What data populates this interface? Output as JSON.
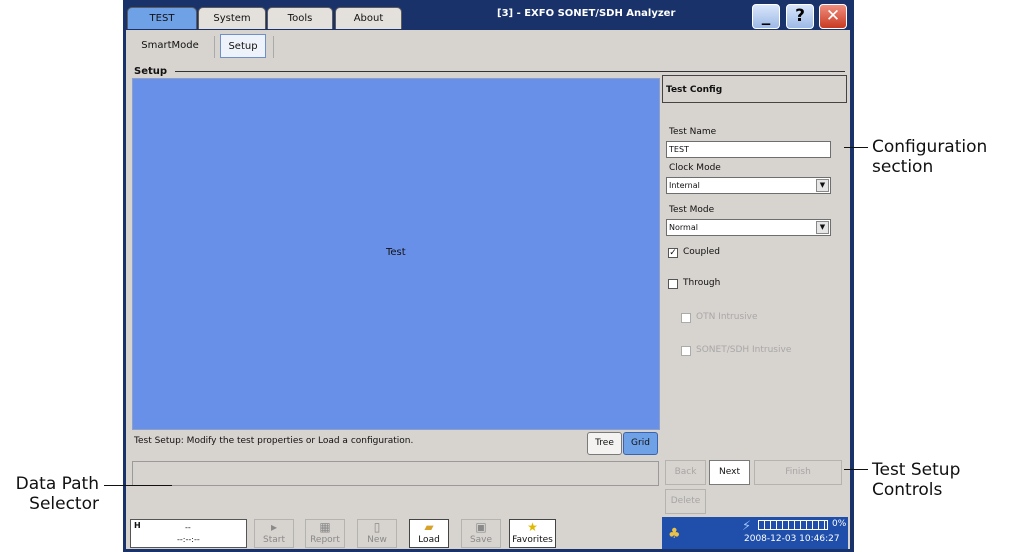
{
  "window": {
    "title": "[3] - EXFO  SONET/SDH Analyzer",
    "min_label": "_",
    "help_label": "?",
    "close_label": "✕"
  },
  "tabs": [
    {
      "label": "TEST",
      "active": true
    },
    {
      "label": "System"
    },
    {
      "label": "Tools"
    },
    {
      "label": "About"
    }
  ],
  "subtabs": [
    {
      "label": "SmartMode"
    },
    {
      "label": "Setup",
      "active": true
    }
  ],
  "setup": {
    "section_label": "Setup",
    "grid_label": "Test",
    "status_text": "Test Setup: Modify the test properties or Load a configuration.",
    "view_tree": "Tree",
    "view_grid": "Grid"
  },
  "config": {
    "header": "Test Config",
    "test_name_label": "Test Name",
    "test_name_value": "TEST",
    "clock_mode_label": "Clock Mode",
    "clock_mode_value": "Internal",
    "test_mode_label": "Test Mode",
    "test_mode_value": "Normal",
    "coupled_label": "Coupled",
    "coupled_checked": true,
    "through_label": "Through",
    "otn_label": "OTN Intrusive",
    "sonet_label": "SONET/SDH Intrusive"
  },
  "nav": {
    "back": "Back",
    "next": "Next",
    "finish": "Finish",
    "delete": "Delete"
  },
  "bottom": {
    "h_label": "H",
    "h_value": "--",
    "h_time": "--:--:--",
    "start": "Start",
    "report": "Report",
    "new": "New",
    "load": "Load",
    "save": "Save",
    "favorites": "Favorites"
  },
  "system": {
    "battery_percent": "0%",
    "timestamp": "2008-12-03 10:46:27"
  },
  "callouts": {
    "config_section": [
      "Configuration",
      "section"
    ],
    "data_path": [
      "Data Path",
      "Selector"
    ],
    "test_setup": [
      "Test Setup",
      "Controls"
    ]
  },
  "colors": {
    "accent": "#6fa1e6",
    "grid_bg": "#6990e9",
    "titlebar": "#19326a",
    "client_bg": "#d7d3cf"
  }
}
